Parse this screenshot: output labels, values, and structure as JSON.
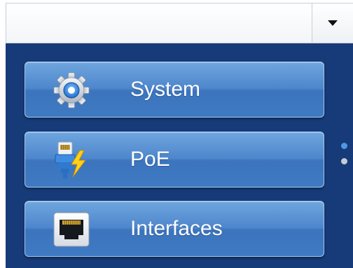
{
  "dropdown": {
    "value": "",
    "toggle_icon": "caret-down-icon"
  },
  "menu": {
    "items": [
      {
        "label": "System",
        "icon": "gear-icon"
      },
      {
        "label": "PoE",
        "icon": "poe-plug-lightning-icon"
      },
      {
        "label": "Interfaces",
        "icon": "ethernet-port-icon"
      }
    ]
  },
  "pager": {
    "pages": 2,
    "current": 1
  },
  "colors": {
    "panel_bg": "#163b78",
    "button_top": "#6fa6de",
    "button_bottom": "#3e7ac3",
    "active_dot": "#4f98e6",
    "inactive_dot": "#c5ccd6"
  }
}
